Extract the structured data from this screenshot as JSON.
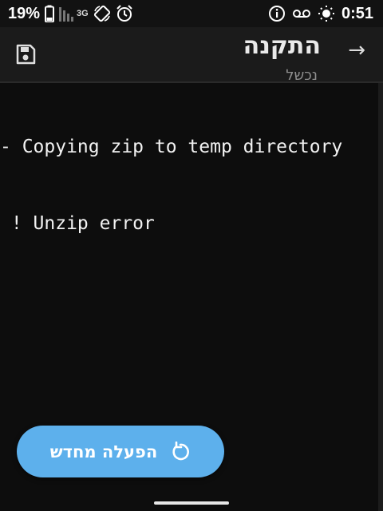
{
  "status_bar": {
    "battery_percent": "19%",
    "network_type": "3G",
    "time": "0:51"
  },
  "toolbar": {
    "title": "התקנה",
    "subtitle": "נכשל",
    "back_arrow": "→",
    "save_icon": "save-icon"
  },
  "console": {
    "lines": [
      "- Copying zip to temp directory",
      " ! Unzip error"
    ]
  },
  "fab": {
    "label": "הפעלה מחדש",
    "icon": "restart-icon"
  },
  "colors": {
    "background": "#0d0d0d",
    "toolbar": "#1b1b1b",
    "accent": "#5db0ec"
  }
}
